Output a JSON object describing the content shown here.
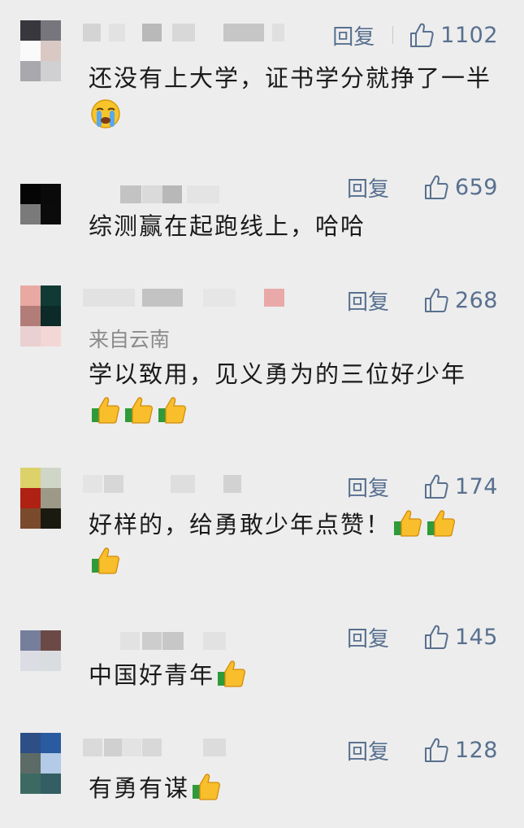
{
  "colors": {
    "background": "#ededed",
    "action_blue": "#58708f",
    "text": "#1a1a1a",
    "location_gray": "#8b8b8b"
  },
  "comments": [
    {
      "reply_label": "回复",
      "likes": "1102",
      "location": "",
      "text": "还没有上大学，证书学分就挣了一半",
      "emoji": [
        "crying-face-icon"
      ]
    },
    {
      "reply_label": "回复",
      "likes": "659",
      "location": "",
      "text": "综测赢在起跑线上，哈哈",
      "emoji": []
    },
    {
      "reply_label": "回复",
      "likes": "268",
      "location": "来自云南",
      "text": "学以致用，见义勇为的三位好少年",
      "emoji": [
        "thumbs-up-icon",
        "thumbs-up-icon",
        "thumbs-up-icon"
      ]
    },
    {
      "reply_label": "回复",
      "likes": "174",
      "location": "",
      "text": "好样的，给勇敢少年点赞！",
      "emoji": [
        "thumbs-up-icon",
        "thumbs-up-icon",
        "thumbs-up-icon"
      ]
    },
    {
      "reply_label": "回复",
      "likes": "145",
      "location": "",
      "text": "中国好青年",
      "emoji": [
        "thumbs-up-icon"
      ]
    },
    {
      "reply_label": "回复",
      "likes": "128",
      "location": "",
      "text": "有勇有谋",
      "emoji": [
        "thumbs-up-icon"
      ]
    }
  ]
}
